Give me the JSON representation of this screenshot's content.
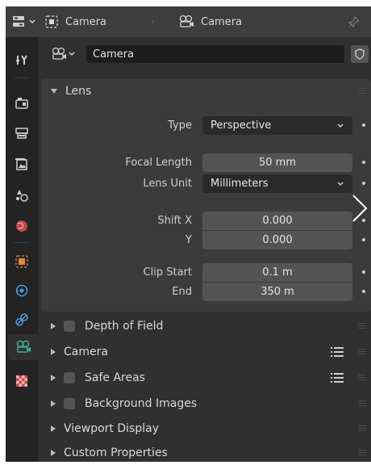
{
  "header": {
    "object_name": "Camera",
    "data_name": "Camera"
  },
  "sidebar": {
    "tabs": [
      {
        "icon": "tool-icon"
      },
      {
        "icon": "render-icon"
      },
      {
        "icon": "output-icon"
      },
      {
        "icon": "view-layer-icon"
      },
      {
        "icon": "scene-icon"
      },
      {
        "icon": "world-icon"
      },
      {
        "icon": "object-icon"
      },
      {
        "icon": "modifier-physics-icon"
      },
      {
        "icon": "constraint-icon"
      },
      {
        "icon": "camera-data-icon",
        "active": true
      },
      {
        "icon": "texture-icon"
      }
    ]
  },
  "datablock": {
    "name": "Camera"
  },
  "lens": {
    "title": "Lens",
    "type_label": "Type",
    "type_value": "Perspective",
    "focal_length_label": "Focal Length",
    "focal_length_value": "50 mm",
    "lens_unit_label": "Lens Unit",
    "lens_unit_value": "Millimeters",
    "shift_x_label": "Shift X",
    "shift_x_value": "0.000",
    "shift_y_label": "Y",
    "shift_y_value": "0.000",
    "clip_start_label": "Clip Start",
    "clip_start_value": "0.1 m",
    "clip_end_label": "End",
    "clip_end_value": "350 m"
  },
  "panels": {
    "depth_of_field": "Depth of Field",
    "camera": "Camera",
    "safe_areas": "Safe Areas",
    "background_images": "Background Images",
    "viewport_display": "Viewport Display",
    "custom_properties": "Custom Properties"
  },
  "colors": {
    "background": "#303030",
    "panel": "#3b3b3b",
    "field": "#545454",
    "dropdown": "#2a2a2a",
    "accent_green": "#3fb39b"
  }
}
